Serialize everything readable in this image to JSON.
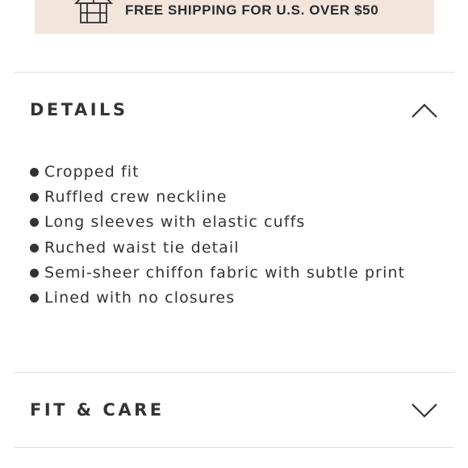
{
  "banner": {
    "icon": "shipping-box-icon",
    "text": "FREE SHIPPING FOR U.S. OVER $50",
    "background": "#f2e5dc"
  },
  "sections": [
    {
      "title": "DETAILS",
      "expanded": true,
      "toggle_icon": "chevron-up-icon",
      "items": [
        "Cropped fit",
        "Ruffled crew neckline",
        "Long sleeves with elastic cuffs",
        "Ruched waist tie detail",
        "Semi-sheer chiffon fabric with subtle print",
        "Lined with no closures"
      ]
    },
    {
      "title": "FIT & CARE",
      "expanded": false,
      "toggle_icon": "chevron-down-icon"
    }
  ]
}
